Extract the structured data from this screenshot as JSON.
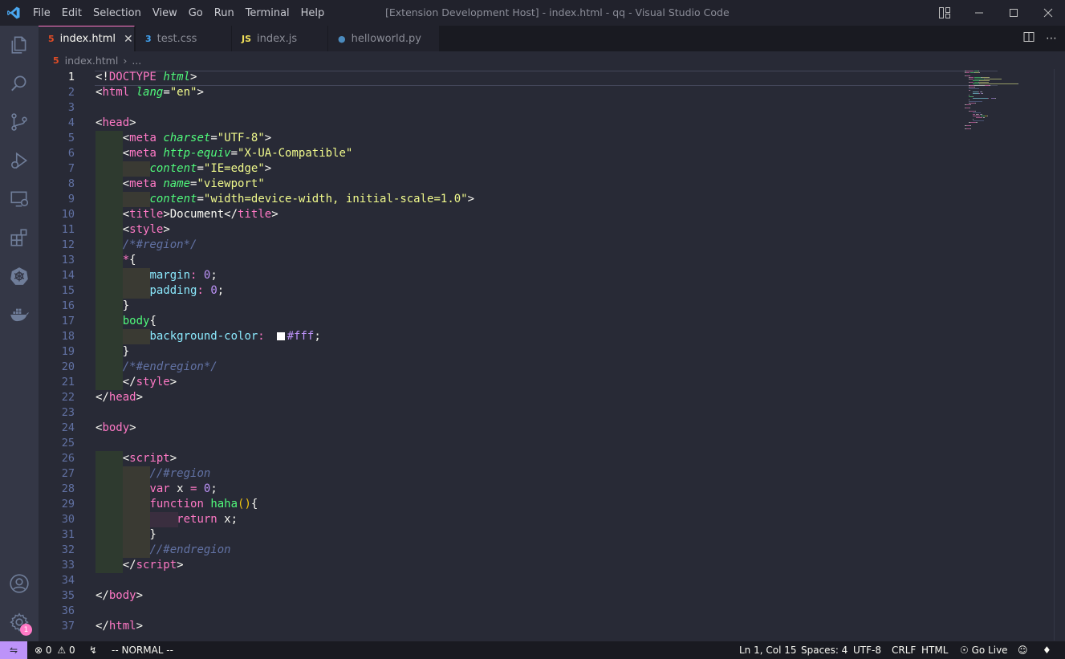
{
  "window": {
    "title": "[Extension Development Host] - index.html - qq - Visual Studio Code",
    "menu": [
      "File",
      "Edit",
      "Selection",
      "View",
      "Go",
      "Run",
      "Terminal",
      "Help"
    ]
  },
  "tabs": [
    {
      "label": "index.html",
      "icon": "html5-icon",
      "icon_color": "#e44d26",
      "active": true
    },
    {
      "label": "test.css",
      "icon": "css3-icon",
      "icon_color": "#42a5f5",
      "active": false
    },
    {
      "label": "index.js",
      "icon": "js-icon",
      "icon_color": "#f1e05a",
      "active": false
    },
    {
      "label": "helloworld.py",
      "icon": "python-icon",
      "icon_color": "#4b8bbe",
      "active": false
    }
  ],
  "breadcrumb": {
    "file": "index.html",
    "rest": "..."
  },
  "activity_bar": [
    "files-icon",
    "search-icon",
    "source-control-icon",
    "run-debug-icon",
    "remote-explorer-icon",
    "extensions-icon",
    "kubernetes-icon",
    "docker-icon",
    "account-icon",
    "settings-gear-icon"
  ],
  "settings_badge": "1",
  "code": {
    "current_line": 1,
    "lines": [
      [
        [
          "t-text",
          "<!"
        ],
        [
          "t-tag",
          "DOCTYPE"
        ],
        [
          "t-text",
          " "
        ],
        [
          "t-attr",
          "html"
        ],
        [
          "t-text",
          ">"
        ]
      ],
      [
        [
          "t-text",
          "<"
        ],
        [
          "t-tag",
          "html"
        ],
        [
          "t-text",
          " "
        ],
        [
          "t-attr",
          "lang"
        ],
        [
          "t-text",
          "="
        ],
        [
          "t-str",
          "\"en\""
        ],
        [
          "t-text",
          ">"
        ]
      ],
      [],
      [
        [
          "t-text",
          "<"
        ],
        [
          "t-tag",
          "head"
        ],
        [
          "t-text",
          ">"
        ]
      ],
      [
        [
          "t-text",
          "    <"
        ],
        [
          "t-tag",
          "meta"
        ],
        [
          "t-text",
          " "
        ],
        [
          "t-attr",
          "charset"
        ],
        [
          "t-text",
          "="
        ],
        [
          "t-str",
          "\"UTF-8\""
        ],
        [
          "t-text",
          ">"
        ]
      ],
      [
        [
          "t-text",
          "    <"
        ],
        [
          "t-tag",
          "meta"
        ],
        [
          "t-text",
          " "
        ],
        [
          "t-attr",
          "http-equiv"
        ],
        [
          "t-text",
          "="
        ],
        [
          "t-str",
          "\"X-UA-Compatible\""
        ]
      ],
      [
        [
          "t-text",
          "        "
        ],
        [
          "t-attr",
          "content"
        ],
        [
          "t-text",
          "="
        ],
        [
          "t-str",
          "\"IE=edge\""
        ],
        [
          "t-text",
          ">"
        ]
      ],
      [
        [
          "t-text",
          "    <"
        ],
        [
          "t-tag",
          "meta"
        ],
        [
          "t-text",
          " "
        ],
        [
          "t-attr",
          "name"
        ],
        [
          "t-text",
          "="
        ],
        [
          "t-str",
          "\"viewport\""
        ]
      ],
      [
        [
          "t-text",
          "        "
        ],
        [
          "t-attr",
          "content"
        ],
        [
          "t-text",
          "="
        ],
        [
          "t-str",
          "\"width=device-width, initial-scale=1.0\""
        ],
        [
          "t-text",
          ">"
        ]
      ],
      [
        [
          "t-text",
          "    <"
        ],
        [
          "t-tag",
          "title"
        ],
        [
          "t-text",
          ">Document</"
        ],
        [
          "t-tag",
          "title"
        ],
        [
          "t-text",
          ">"
        ]
      ],
      [
        [
          "t-text",
          "    <"
        ],
        [
          "t-tag",
          "style"
        ],
        [
          "t-text",
          ">"
        ]
      ],
      [
        [
          "t-text",
          "    "
        ],
        [
          "t-comm",
          "/*#region*/"
        ]
      ],
      [
        [
          "t-text",
          "    "
        ],
        [
          "t-kw",
          "*"
        ],
        [
          "t-text",
          "{"
        ]
      ],
      [
        [
          "t-text",
          "        "
        ],
        [
          "t-prop",
          "margin"
        ],
        [
          "t-kw",
          ":"
        ],
        [
          "t-text",
          " "
        ],
        [
          "t-num",
          "0"
        ],
        [
          "t-text",
          ";"
        ]
      ],
      [
        [
          "t-text",
          "        "
        ],
        [
          "t-prop",
          "padding"
        ],
        [
          "t-kw",
          ":"
        ],
        [
          "t-text",
          " "
        ],
        [
          "t-num",
          "0"
        ],
        [
          "t-text",
          ";"
        ]
      ],
      [
        [
          "t-text",
          "    }"
        ]
      ],
      [
        [
          "t-text",
          "    "
        ],
        [
          "t-sel",
          "body"
        ],
        [
          "t-text",
          "{"
        ]
      ],
      [
        [
          "t-text",
          "        "
        ],
        [
          "t-prop",
          "background-color"
        ],
        [
          "t-kw",
          ":"
        ],
        [
          "t-text",
          "  "
        ],
        [
          "swatch",
          "#ffffff"
        ],
        [
          "t-num",
          "#fff"
        ],
        [
          "t-text",
          ";"
        ]
      ],
      [
        [
          "t-text",
          "    }"
        ]
      ],
      [
        [
          "t-text",
          "    "
        ],
        [
          "t-comm",
          "/*#endregion*/"
        ]
      ],
      [
        [
          "t-text",
          "    </"
        ],
        [
          "t-tag",
          "style"
        ],
        [
          "t-text",
          ">"
        ]
      ],
      [
        [
          "t-text",
          "</"
        ],
        [
          "t-tag",
          "head"
        ],
        [
          "t-text",
          ">"
        ]
      ],
      [],
      [
        [
          "t-text",
          "<"
        ],
        [
          "t-tag",
          "body"
        ],
        [
          "t-text",
          ">"
        ]
      ],
      [],
      [
        [
          "t-text",
          "    <"
        ],
        [
          "t-tag",
          "script"
        ],
        [
          "t-text",
          ">"
        ]
      ],
      [
        [
          "t-text",
          "        "
        ],
        [
          "t-comm",
          "//#region"
        ]
      ],
      [
        [
          "t-text",
          "        "
        ],
        [
          "t-kw",
          "var"
        ],
        [
          "t-text",
          " x "
        ],
        [
          "t-kw",
          "="
        ],
        [
          "t-text",
          " "
        ],
        [
          "t-num",
          "0"
        ],
        [
          "t-text",
          ";"
        ]
      ],
      [
        [
          "t-text",
          "        "
        ],
        [
          "t-kw",
          "function"
        ],
        [
          "t-text",
          " "
        ],
        [
          "t-fn",
          "haha"
        ],
        [
          "t-paren",
          "()"
        ],
        [
          "t-text",
          "{"
        ]
      ],
      [
        [
          "t-text",
          "            "
        ],
        [
          "t-kw",
          "return"
        ],
        [
          "t-text",
          " x;"
        ]
      ],
      [
        [
          "t-text",
          "        }"
        ]
      ],
      [
        [
          "t-text",
          "        "
        ],
        [
          "t-comm",
          "//#endregion"
        ]
      ],
      [
        [
          "t-text",
          "    </"
        ],
        [
          "t-tag",
          "script"
        ],
        [
          "t-text",
          ">"
        ]
      ],
      [],
      [
        [
          "t-text",
          "</"
        ],
        [
          "t-tag",
          "body"
        ],
        [
          "t-text",
          ">"
        ]
      ],
      [],
      [
        [
          "t-text",
          "</"
        ],
        [
          "t-tag",
          "html"
        ],
        [
          "t-text",
          ">"
        ]
      ]
    ]
  },
  "status": {
    "errors": "0",
    "warnings": "0",
    "mode": "-- NORMAL --",
    "position": "Ln 1, Col 15",
    "spaces": "Spaces: 4",
    "encoding": "UTF-8",
    "eol": "CRLF",
    "language": "HTML",
    "golive": "Go Live"
  }
}
